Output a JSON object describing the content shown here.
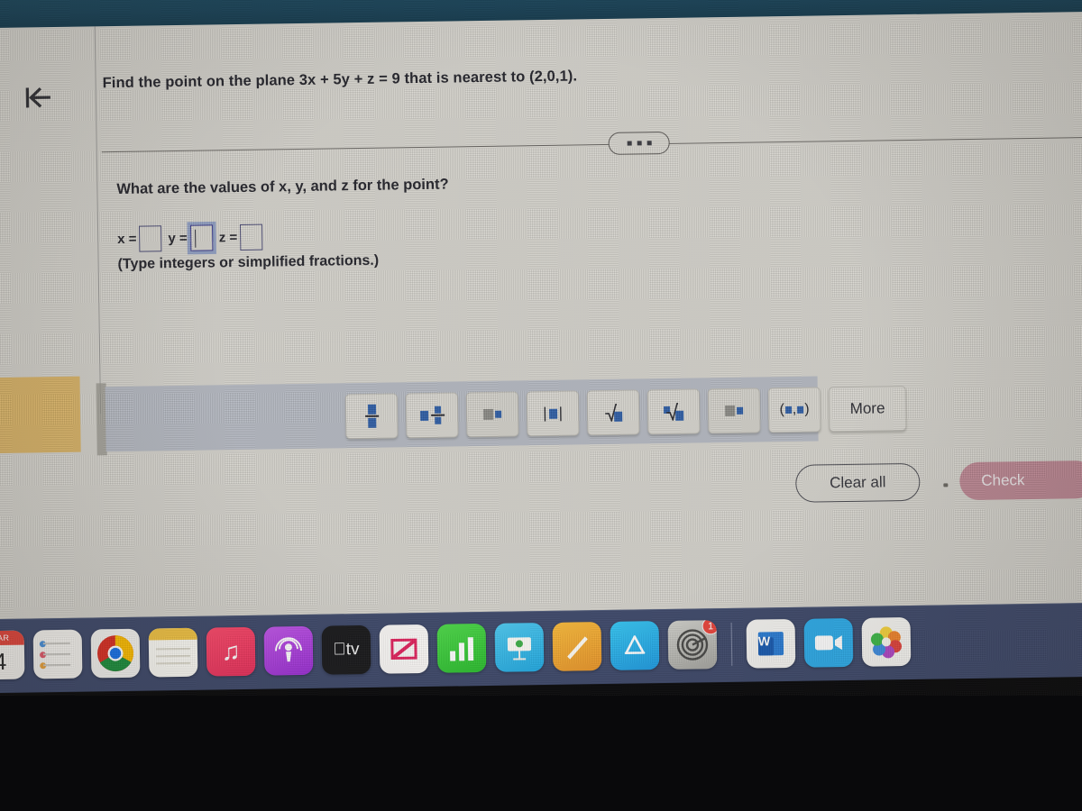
{
  "nav": {
    "back_icon": "back-to-start-arrow-icon"
  },
  "question": {
    "prompt": "Find the point on the plane 3x + 5y + z = 9 that is nearest to (2,0,1).",
    "expand_icon": "ellipsis-icon",
    "sub_prompt": "What are the values of x, y, and z for the point?",
    "hint": "(Type integers or simplified fractions.)"
  },
  "answer_fields": [
    {
      "label": "x =",
      "value": "",
      "focused": false
    },
    {
      "label": "y =",
      "value": "",
      "focused": true
    },
    {
      "label": "z =",
      "value": "",
      "focused": false
    }
  ],
  "math_palette": {
    "buttons": [
      {
        "name": "fraction-button",
        "glyph": "fraction"
      },
      {
        "name": "mixed-number-button",
        "glyph": "mixed-number"
      },
      {
        "name": "exponent-button",
        "glyph": "exponent"
      },
      {
        "name": "absolute-value-button",
        "glyph": "absolute-value"
      },
      {
        "name": "square-root-button",
        "glyph": "square-root"
      },
      {
        "name": "nth-root-button",
        "glyph": "nth-root"
      },
      {
        "name": "subscript-button",
        "glyph": "subscript"
      },
      {
        "name": "ordered-pair-button",
        "glyph": "ordered-pair"
      },
      {
        "name": "more-button",
        "glyph": "text",
        "label": "More"
      }
    ]
  },
  "actions": {
    "clear_all_label": "Clear all",
    "check_label": "Check",
    "check_color": "#c28b97"
  },
  "dock": {
    "items": [
      {
        "name": "calendar",
        "month": "MAR",
        "day": "4",
        "running": false,
        "badge": ""
      },
      {
        "name": "reminders",
        "running": false,
        "badge": ""
      },
      {
        "name": "chrome",
        "running": true,
        "badge": ""
      },
      {
        "name": "notes",
        "running": false,
        "badge": ""
      },
      {
        "name": "music",
        "running": true,
        "badge": ""
      },
      {
        "name": "podcasts",
        "running": false,
        "badge": ""
      },
      {
        "name": "apple-tv",
        "label": "tv",
        "running": false,
        "badge": ""
      },
      {
        "name": "news",
        "running": false,
        "badge": ""
      },
      {
        "name": "numbers",
        "running": false,
        "badge": ""
      },
      {
        "name": "keynote",
        "running": false,
        "badge": ""
      },
      {
        "name": "pages",
        "running": false,
        "badge": ""
      },
      {
        "name": "app-store",
        "running": false,
        "badge": ""
      },
      {
        "name": "system-preferences",
        "running": false,
        "badge": "1"
      },
      {
        "name": "microsoft-word",
        "label": "W",
        "running": true,
        "badge": ""
      },
      {
        "name": "zoom",
        "running": true,
        "badge": ""
      },
      {
        "name": "photos",
        "running": false,
        "badge": ""
      }
    ]
  },
  "colors": {
    "wallpaper": "#1d4b60",
    "page_bg": "#d9d7d0",
    "dock_bg": "#3f4a6b",
    "accent_blue": "#2f5fa8",
    "focus_ring": "#5a76be",
    "sidebar_orange": "#e0b96a",
    "toolbar_grey": "#b9bdc6"
  }
}
